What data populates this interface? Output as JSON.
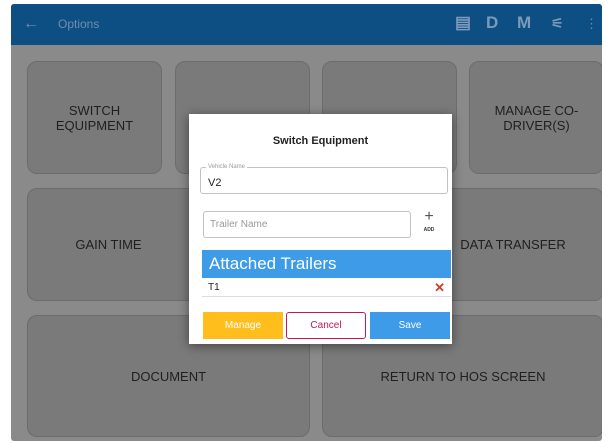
{
  "appbar": {
    "back_icon": "arrow-back-icon",
    "title": "Options",
    "actions": [
      {
        "name": "form-icon",
        "label": "▤"
      },
      {
        "name": "d",
        "label": "D"
      },
      {
        "name": "m",
        "label": "M"
      },
      {
        "name": "eld-icon",
        "label": "⚟"
      }
    ],
    "menu_icon": "⋮"
  },
  "tiles": {
    "switch_equipment": "SWITCH EQUIPMENT",
    "manage_codriver": "MANAGE CO-DRIVER(S)",
    "gain_time": "GAIN TIME",
    "data_transfer": "DATA TRANSFER",
    "document": "DOCUMENT",
    "return_hos": "RETURN TO HOS SCREEN"
  },
  "dialog": {
    "title": "Switch Equipment",
    "vehicle_label": "Vehicle Name",
    "vehicle_value": "V2",
    "trailer_placeholder": "Trailer Name",
    "add_plus": "+",
    "add_label": "ADD",
    "attached_header": "Attached Trailers",
    "trailers": [
      "T1"
    ],
    "remove_glyph": "✕",
    "buttons": {
      "manage": "Manage",
      "cancel": "Cancel",
      "save": "Save"
    }
  },
  "colors": {
    "appbar": "#0d4e83",
    "accent_blue": "#3e9be8",
    "manage_yellow": "#ffbe1c",
    "cancel_magenta": "#c2185b",
    "remove_red": "#d43b2a"
  }
}
